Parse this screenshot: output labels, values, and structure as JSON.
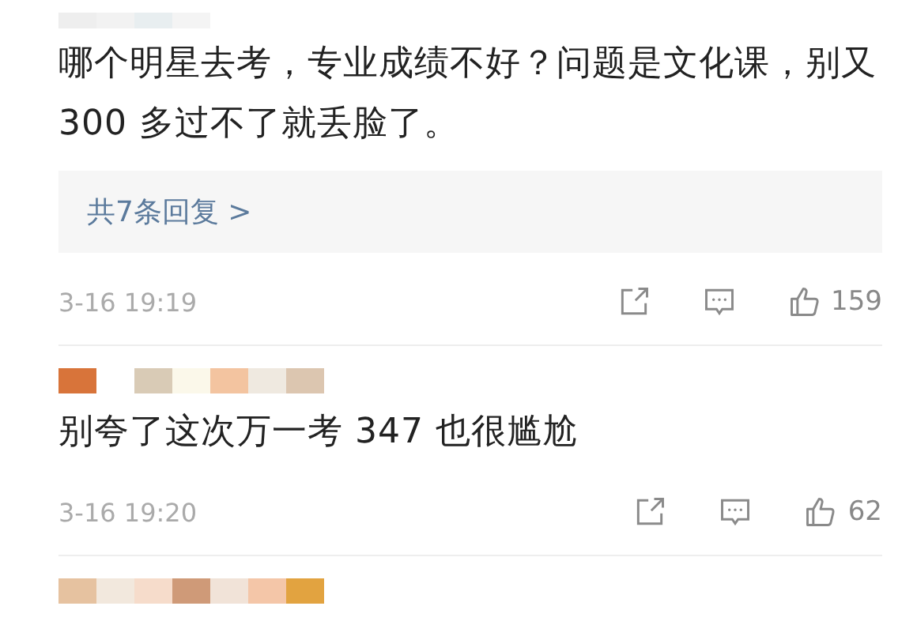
{
  "comments": [
    {
      "text": "哪个明星去考，专业成绩不好？问题是文化课，别又 300 多过不了就丢脸了。",
      "replies": "共7条回复 >",
      "time": "3-16 19:19",
      "likes": "159"
    },
    {
      "text": "别夸了这次万一考 347 也很尴尬",
      "time": "3-16 19:20",
      "likes": "62"
    }
  ]
}
